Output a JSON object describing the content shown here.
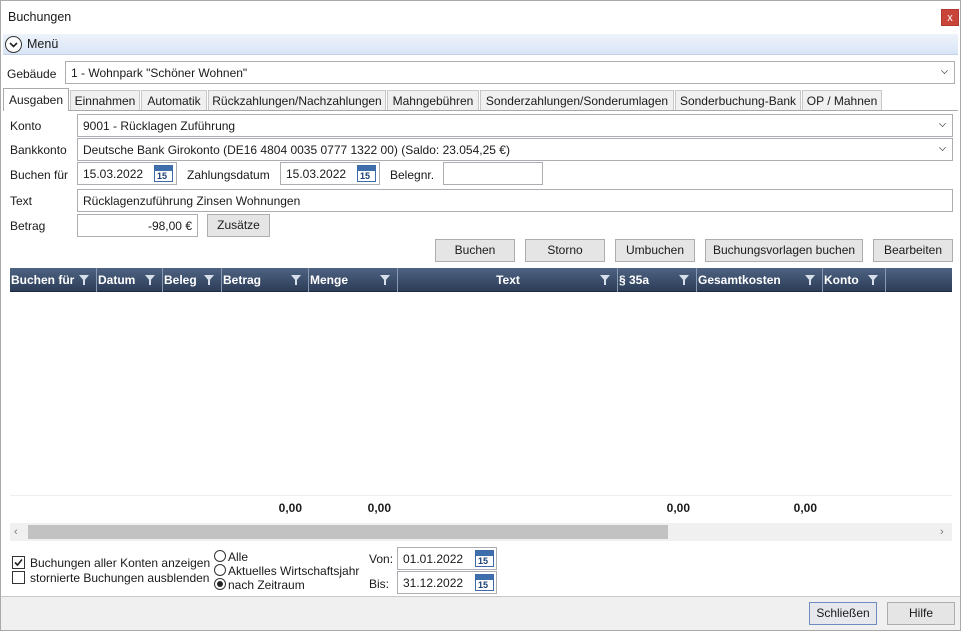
{
  "window": {
    "title": "Buchungen",
    "close_label": "x"
  },
  "menu": {
    "label": "Menü"
  },
  "building": {
    "label": "Gebäude",
    "value": "1 - Wohnpark \"Schöner Wohnen\""
  },
  "tabs": [
    {
      "label": "Ausgaben",
      "active": true
    },
    {
      "label": "Einnahmen"
    },
    {
      "label": "Automatik"
    },
    {
      "label": "Rückzahlungen/Nachzahlungen"
    },
    {
      "label": "Mahngebühren"
    },
    {
      "label": "Sonderzahlungen/Sonderumlagen"
    },
    {
      "label": "Sonderbuchung-Bank"
    },
    {
      "label": "OP / Mahnen"
    }
  ],
  "form": {
    "konto_label": "Konto",
    "konto_value": "9001 - Rücklagen Zuführung",
    "bankkonto_label": "Bankkonto",
    "bankkonto_value": "Deutsche Bank Girokonto (DE16 4804 0035 0777 1322 00) (Saldo: 23.054,25 €)",
    "buchen_fuer_label": "Buchen für",
    "buchen_fuer_value": "15.03.2022",
    "zahlungsdatum_label": "Zahlungsdatum",
    "zahlungsdatum_value": "15.03.2022",
    "belegnr_label": "Belegnr.",
    "belegnr_value": "",
    "text_label": "Text",
    "text_value": "Rücklagenzuführung Zinsen Wohnungen",
    "betrag_label": "Betrag",
    "betrag_value": "-98,00 €",
    "zusaetze_label": "Zusätze",
    "calendar_day": "15"
  },
  "actions": {
    "buchen": "Buchen",
    "storno": "Storno",
    "umbuchen": "Umbuchen",
    "vorlagen": "Buchungsvorlagen buchen",
    "bearbeiten": "Bearbeiten"
  },
  "grid": {
    "columns": [
      "Buchen für",
      "Datum",
      "Beleg",
      "Betrag",
      "Menge",
      "Text",
      "§ 35a",
      "Gesamtkosten",
      "Konto"
    ],
    "sums": {
      "betrag": "0,00",
      "menge": "0,00",
      "par35a": "0,00",
      "gesamtkosten": "0,00"
    }
  },
  "options": {
    "show_all_accounts": "Buchungen aller Konten anzeigen",
    "show_all_accounts_checked": true,
    "hide_cancelled": "stornierte Buchungen ausblenden",
    "hide_cancelled_checked": false,
    "radio_all": "Alle",
    "radio_fiscal": "Aktuelles Wirtschaftsjahr",
    "radio_period": "nach Zeitraum",
    "radio_selected": "nach Zeitraum",
    "von_label": "Von:",
    "von_value": "01.01.2022",
    "bis_label": "Bis:",
    "bis_value": "31.12.2022"
  },
  "footer": {
    "schliessen": "Schließen",
    "hilfe": "Hilfe"
  }
}
